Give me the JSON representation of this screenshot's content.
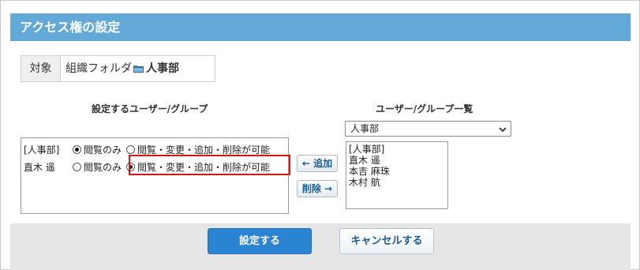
{
  "page": {
    "title": "アクセス権の設定"
  },
  "target": {
    "label": "対象",
    "path_prefix": "組織フォルダ",
    "folder_icon": "folder-icon",
    "folder_name": "人事部"
  },
  "left_panel": {
    "heading": "設定するユーザー/グループ",
    "rows": [
      {
        "name": "[人事部]",
        "options": [
          "閲覧のみ",
          "閲覧・変更・追加・削除が可能"
        ],
        "selected": 0
      },
      {
        "name": "直木 遥",
        "options": [
          "閲覧のみ",
          "閲覧・変更・追加・削除が可能"
        ],
        "selected": 1
      }
    ],
    "highlight_color": "#d01818"
  },
  "middle": {
    "add_label": "← 追加",
    "remove_label": "削除 →"
  },
  "right_panel": {
    "heading": "ユーザー/グループ一覧",
    "group_select_value": "人事部",
    "users": [
      "[人事部]",
      "直木 遥",
      "本吉 麻珠",
      "木村 航"
    ]
  },
  "footer": {
    "submit_label": "設定する",
    "cancel_label": "キャンセルする"
  },
  "colors": {
    "title_bar": "#62a9d8",
    "primary_button": "#2a84d2",
    "footer_bg": "#e6e6e6"
  }
}
